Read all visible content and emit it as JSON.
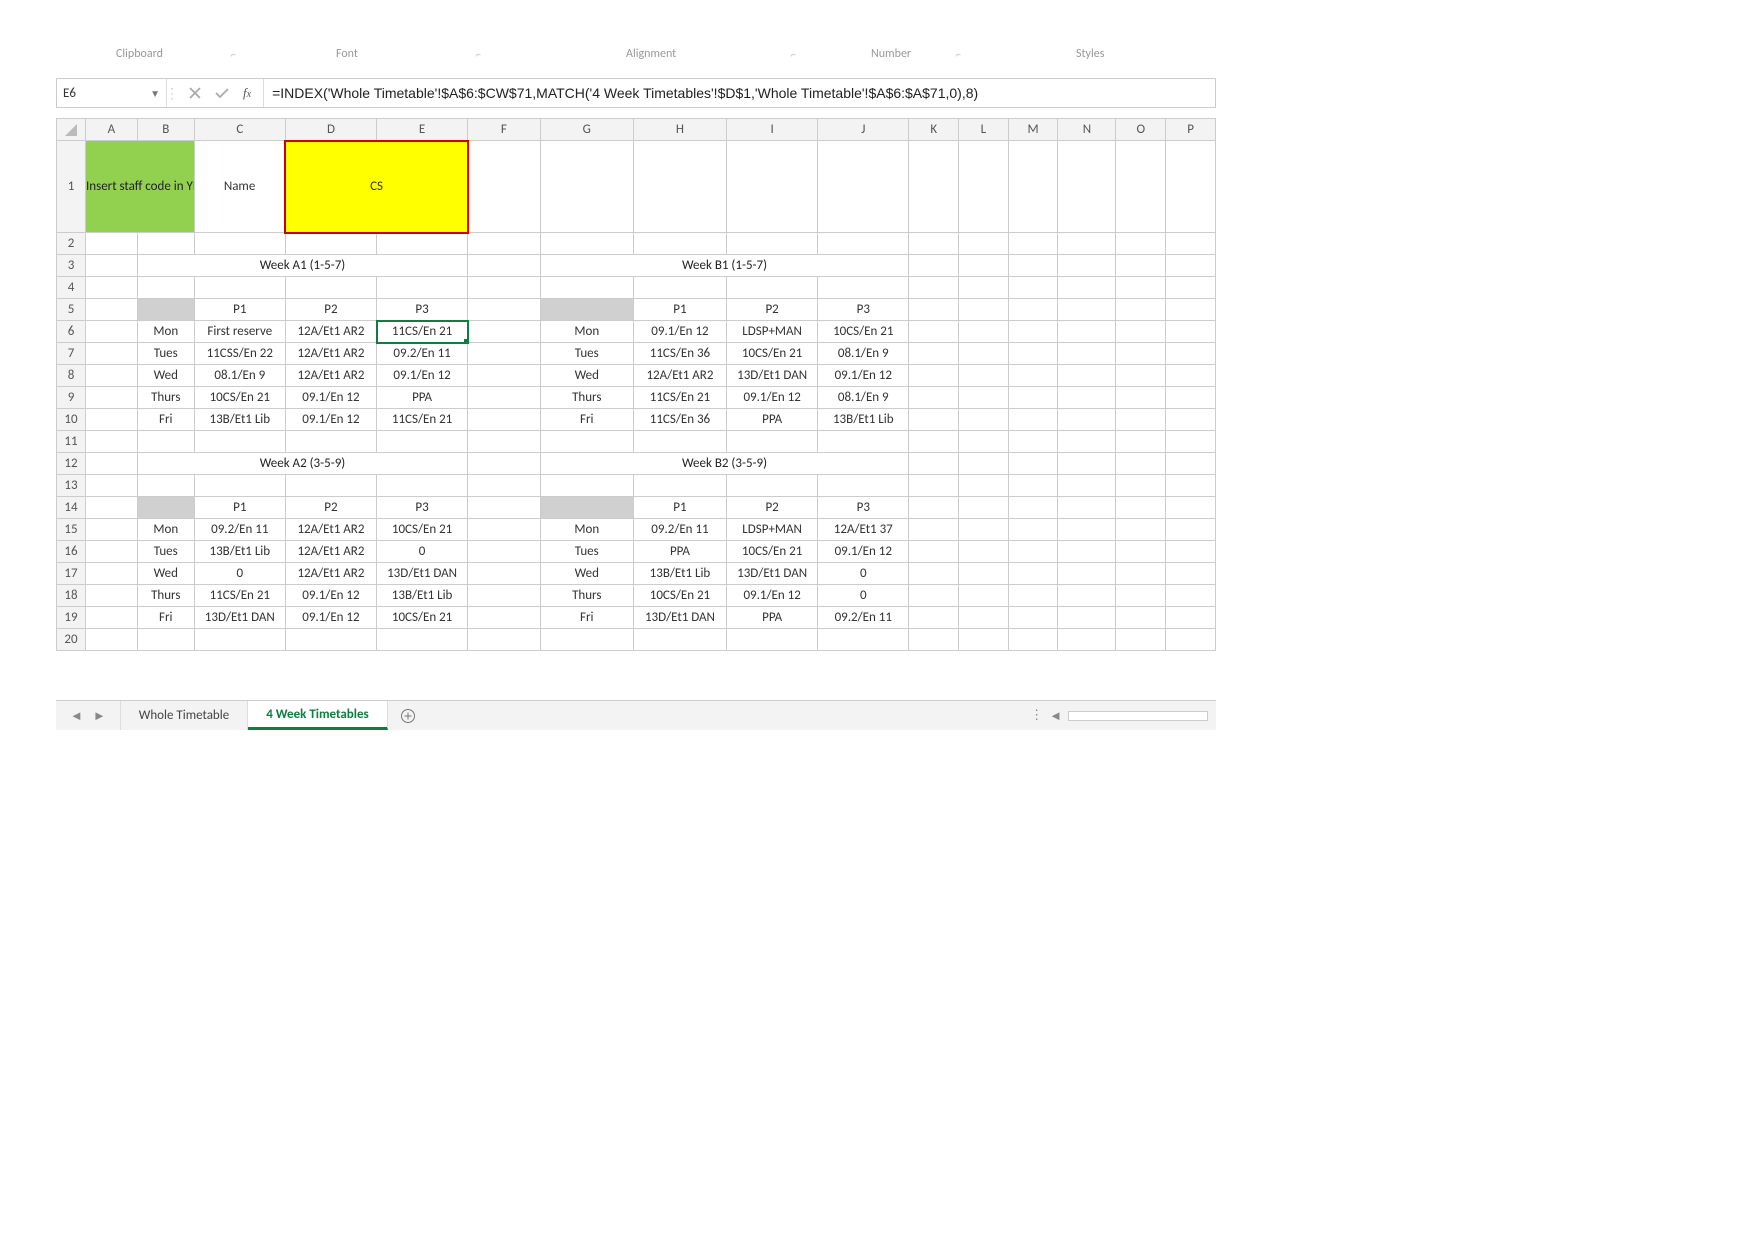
{
  "ribbon_groups": {
    "clipboard": "Clipboard",
    "font": "Font",
    "alignment": "Alignment",
    "number": "Number",
    "styles": "Styles"
  },
  "name_box": {
    "value": "E6"
  },
  "formula": "=INDEX('Whole Timetable'!$A$6:$CW$71,MATCH('4 Week Timetables'!$D$1,'Whole Timetable'!$A$6:$A$71,0),8)",
  "columns": [
    "A",
    "B",
    "C",
    "D",
    "E",
    "F",
    "G",
    "H",
    "I",
    "J",
    "K",
    "L",
    "M",
    "N",
    "O",
    "P"
  ],
  "rows": [
    "1",
    "2",
    "3",
    "4",
    "5",
    "6",
    "7",
    "8",
    "9",
    "10",
    "11",
    "12",
    "13",
    "14",
    "15",
    "16",
    "17",
    "18",
    "19",
    "20"
  ],
  "instr": "Insert staff code in YELLOW BOX in CAPITAL LETTERS",
  "name_label": "Name",
  "yellow_value": "CS",
  "section_titles": {
    "a1": "Week A1 (1-5-7)",
    "b1": "Week B1 (1-5-7)",
    "a2": "Week A2 (3-5-9)",
    "b2": "Week B2 (3-5-9)"
  },
  "period_labels": {
    "p1": "P1",
    "p2": "P2",
    "p3": "P3"
  },
  "days": [
    "Mon",
    "Tues",
    "Wed",
    "Thurs",
    "Fri"
  ],
  "left_a": [
    [
      "First reserve",
      "12A/Et1 AR2",
      "11CS/En 21"
    ],
    [
      "11CSS/En 22",
      "12A/Et1 AR2",
      "09.2/En 11"
    ],
    [
      "08.1/En 9",
      "12A/Et1 AR2",
      "09.1/En 12"
    ],
    [
      "10CS/En 21",
      "09.1/En 12",
      "PPA"
    ],
    [
      "13B/Et1 Lib",
      "09.1/En 12",
      "11CS/En 21"
    ]
  ],
  "right_b": [
    [
      "09.1/En 12",
      "LDSP+MAN",
      "10CS/En 21"
    ],
    [
      "11CS/En 36",
      "10CS/En 21",
      "08.1/En 9"
    ],
    [
      "12A/Et1 AR2",
      "13D/Et1 DAN",
      "09.1/En 12"
    ],
    [
      "11CS/En 21",
      "09.1/En 12",
      "08.1/En 9"
    ],
    [
      "11CS/En 36",
      "PPA",
      "13B/Et1 Lib"
    ]
  ],
  "left_a2": [
    [
      "09.2/En 11",
      "12A/Et1 AR2",
      "10CS/En 21"
    ],
    [
      "13B/Et1 Lib",
      "12A/Et1 AR2",
      "0"
    ],
    [
      "0",
      "12A/Et1 AR2",
      "13D/Et1 DAN"
    ],
    [
      "11CS/En 21",
      "09.1/En 12",
      "13B/Et1 Lib"
    ],
    [
      "13D/Et1 DAN",
      "09.1/En 12",
      "10CS/En 21"
    ]
  ],
  "right_b2": [
    [
      "09.2/En 11",
      "LDSP+MAN",
      "12A/Et1 37"
    ],
    [
      "PPA",
      "10CS/En 21",
      "09.1/En 12"
    ],
    [
      "13B/Et1 Lib",
      "13D/Et1 DAN",
      "0"
    ],
    [
      "10CS/En 21",
      "09.1/En 12",
      "0"
    ],
    [
      "13D/Et1 DAN",
      "PPA",
      "09.2/En 11"
    ]
  ],
  "tabs": {
    "whole": "Whole Timetable",
    "four": "4 Week Timetables"
  }
}
